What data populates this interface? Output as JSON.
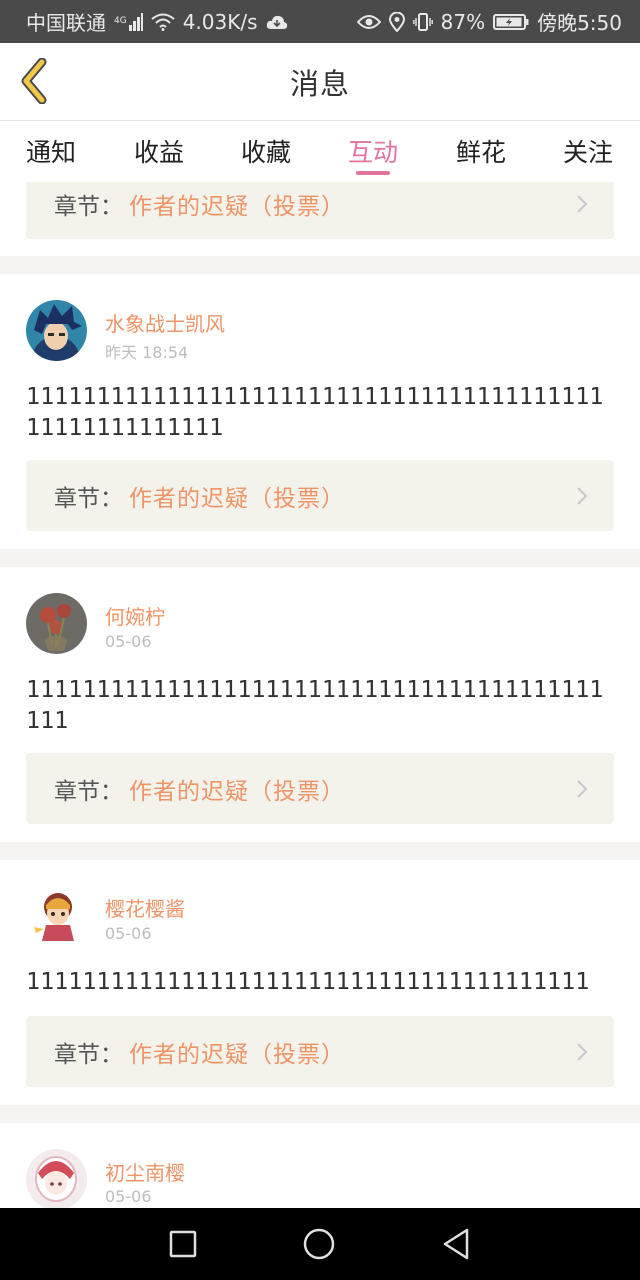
{
  "status_bar": {
    "carrier": "中国联通",
    "network_type": "4G",
    "net_speed": "4.03K/s",
    "battery": "87%",
    "time": "傍晚5:50"
  },
  "header": {
    "title": "消息"
  },
  "tabs": [
    {
      "label": "通知",
      "active": false
    },
    {
      "label": "收益",
      "active": false
    },
    {
      "label": "收藏",
      "active": false
    },
    {
      "label": "互动",
      "active": true
    },
    {
      "label": "鲜花",
      "active": false
    },
    {
      "label": "关注",
      "active": false
    }
  ],
  "chapter_label": "章节：",
  "messages": [
    {
      "chapter_title": "作者的迟疑（投票）"
    },
    {
      "username": "水象战士凯风",
      "time": "昨天 18:54",
      "comment": "1111111111111111111111111111111111111111111111111111111",
      "chapter_title": "作者的迟疑（投票）"
    },
    {
      "username": "何婉柠",
      "time": "05-06",
      "comment": "11111111111111111111111111111111111111111111",
      "chapter_title": "作者的迟疑（投票）"
    },
    {
      "username": "樱花樱酱",
      "time": "05-06",
      "comment": "1111111111111111111111111111111111111111",
      "chapter_title": "作者的迟疑（投票）"
    },
    {
      "username": "初尘南樱",
      "time": "05-06"
    }
  ],
  "colors": {
    "accent": "#e2739c",
    "username": "#ef9466",
    "back_arrow": "#f2c84b"
  }
}
